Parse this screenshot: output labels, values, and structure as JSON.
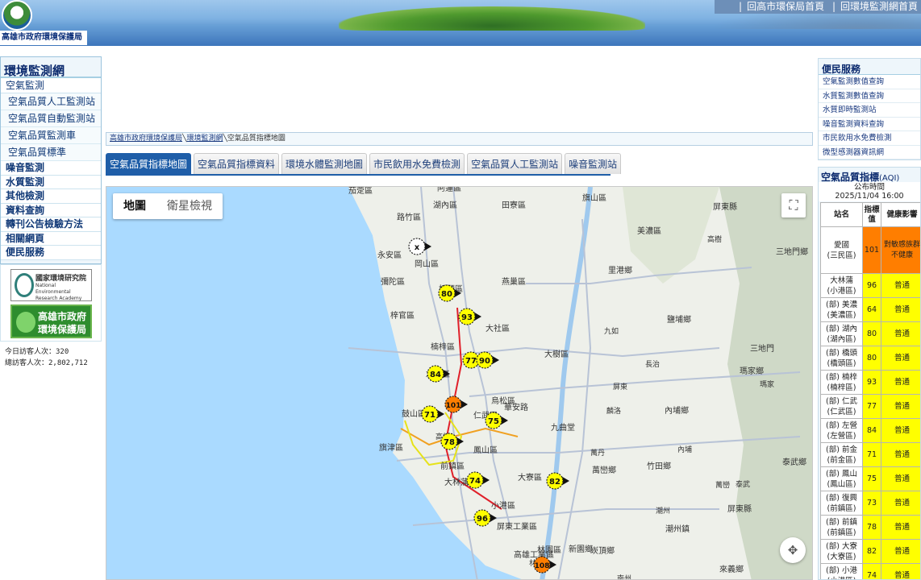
{
  "site": {
    "logo_text": "高雄市政府環境保護局",
    "top_links": [
      "回高市環保局首頁",
      "回環境監測網首頁"
    ]
  },
  "leftnav": {
    "title": "環境監測網",
    "items": [
      {
        "label": "空氣監測"
      },
      {
        "label": "空氣品質人工監測站",
        "sub": true
      },
      {
        "label": "空氣品質自動監測站",
        "sub": true
      },
      {
        "label": "空氣品質監測車",
        "sub": true
      },
      {
        "label": "空氣品質標準",
        "sub": true
      },
      {
        "label": "噪音監測"
      },
      {
        "label": "水質監測"
      },
      {
        "label": "其他檢測"
      },
      {
        "label": "資料查詢"
      },
      {
        "label": "轉刊公告檢驗方法"
      },
      {
        "label": "相關網頁"
      },
      {
        "label": "便民服務"
      }
    ]
  },
  "partners": {
    "nera_zh": "國家環境研究院",
    "nera_en": "National Environmental Research Academy",
    "epb": "高雄市政府\n環境保護局"
  },
  "counter": {
    "today": "今日訪客人次：320",
    "total": "總訪客人次：2,802,712"
  },
  "breadcrumb": [
    "高雄市政府環境保護局",
    "環境監測網",
    "空氣品質指標地圖"
  ],
  "tabs": [
    {
      "label": "空氣品質指標地圖",
      "active": true
    },
    {
      "label": "空氣品質指標資料"
    },
    {
      "label": "環境水體監測地圖"
    },
    {
      "label": "市民飲用水免費檢測"
    },
    {
      "label": "空氣品質人工監測站"
    },
    {
      "label": "噪音監測站"
    }
  ],
  "map": {
    "type_buttons": [
      "地圖",
      "衛星檢視"
    ],
    "active_type": "地圖",
    "labels": [
      "茄萣區",
      "阿蓮區",
      "旗山區",
      "田寮區",
      "湖內區",
      "路竹區",
      "永安區",
      "岡山區",
      "燕巢區",
      "美濃區",
      "屏東縣",
      "彌陀區",
      "里港鄉",
      "高樹",
      "三地門鄉",
      "梓官區",
      "橋頭區",
      "大社區",
      "九如",
      "鹽埔鄉",
      "楠梓區",
      "大樹區",
      "三地門",
      "左營區",
      "屏東",
      "長治",
      "瑪家鄉",
      "瑪家",
      "鼓山區",
      "鳳山區",
      "九曲堂",
      "麟洛",
      "內埔鄉",
      "高雄",
      "旗津區",
      "前鎮區",
      "大寮區",
      "萬丹",
      "萬巒鄉",
      "泰武鄉",
      "竹田鄉",
      "萬巒",
      "小港區",
      "潮州",
      "潮州鎮",
      "泰武",
      "屏東縣",
      "新園鄉",
      "崁頂鄉",
      "林園區",
      "南州",
      "來義鄉",
      "屏東工業區",
      "仁武區",
      "烏松區",
      "內埔",
      "大林蒲",
      "高雄工業區",
      "林園",
      "華安路"
    ],
    "stations": [
      {
        "name": "橋頭",
        "aqi": 80,
        "color": "#ffff00"
      },
      {
        "name": "楠梓",
        "aqi": 93,
        "color": "#ffff00"
      },
      {
        "name": "仁武",
        "aqi": 77,
        "color": "#ffff00"
      },
      {
        "name": "大社",
        "aqi": 90,
        "color": "#ffff00"
      },
      {
        "name": "左營",
        "aqi": 84,
        "color": "#ffff00"
      },
      {
        "name": "愛國",
        "aqi": 101,
        "color": "#ff7e00"
      },
      {
        "name": "鼓山",
        "aqi": 71,
        "color": "#ffff00"
      },
      {
        "name": "鳳山",
        "aqi": 75,
        "color": "#ffff00"
      },
      {
        "name": "前金",
        "aqi": 78,
        "color": "#ffff00"
      },
      {
        "name": "前鎮",
        "aqi": 74,
        "color": "#ffff00"
      },
      {
        "name": "大寮",
        "aqi": 82,
        "color": "#ffff00"
      },
      {
        "name": "小港",
        "aqi": 96,
        "color": "#ffff00"
      },
      {
        "name": "林園",
        "aqi": 108,
        "color": "#ff7e00"
      },
      {
        "name": "美濃",
        "aqi": "x",
        "color": "#ffffff"
      }
    ]
  },
  "services": {
    "title": "便民服務",
    "items": [
      "空氣監測數值查詢",
      "水質監測數值查詢",
      "水質即時監測站",
      "噪音監測資料查詢",
      "市民飲用水免費檢測",
      "微型感測器資訊網"
    ]
  },
  "aqi_panel": {
    "title": "空氣品質指標",
    "title_suffix": "(AQI)",
    "publish_label": "公布時間",
    "publish_time": "2025/11/04 16:00",
    "headers": [
      "站名",
      "指標值",
      "健康影響"
    ],
    "rows": [
      {
        "station": "愛國",
        "district": "(三民區)",
        "aqi": "101",
        "impact": "對敏感族群不健康",
        "color": "#ff7e00"
      },
      {
        "station": "大林蒲",
        "district": "(小港區)",
        "aqi": "96",
        "impact": "普通",
        "color": "#ffff00"
      },
      {
        "station": "(部) 美濃",
        "district": "(美濃區)",
        "aqi": "64",
        "impact": "普通",
        "color": "#ffff00"
      },
      {
        "station": "(部) 湖內",
        "district": "(湖內區)",
        "aqi": "80",
        "impact": "普通",
        "color": "#ffff00"
      },
      {
        "station": "(部) 橋頭",
        "district": "(橋頭區)",
        "aqi": "80",
        "impact": "普通",
        "color": "#ffff00"
      },
      {
        "station": "(部) 楠梓",
        "district": "(楠梓區)",
        "aqi": "93",
        "impact": "普通",
        "color": "#ffff00"
      },
      {
        "station": "(部) 仁武",
        "district": "(仁武區)",
        "aqi": "77",
        "impact": "普通",
        "color": "#ffff00"
      },
      {
        "station": "(部) 左營",
        "district": "(左營區)",
        "aqi": "84",
        "impact": "普通",
        "color": "#ffff00"
      },
      {
        "station": "(部) 前金",
        "district": "(前金區)",
        "aqi": "71",
        "impact": "普通",
        "color": "#ffff00"
      },
      {
        "station": "(部) 鳳山",
        "district": "(鳳山區)",
        "aqi": "75",
        "impact": "普通",
        "color": "#ffff00"
      },
      {
        "station": "(部) 復興",
        "district": "(前鎮區)",
        "aqi": "73",
        "impact": "普通",
        "color": "#ffff00"
      },
      {
        "station": "(部) 前鎮",
        "district": "(前鎮區)",
        "aqi": "78",
        "impact": "普通",
        "color": "#ffff00"
      },
      {
        "station": "(部) 大寮",
        "district": "(大寮區)",
        "aqi": "82",
        "impact": "普通",
        "color": "#ffff00"
      },
      {
        "station": "(部) 小港",
        "district": "(小港區)",
        "aqi": "74",
        "impact": "普通",
        "color": "#ffff00"
      }
    ]
  }
}
